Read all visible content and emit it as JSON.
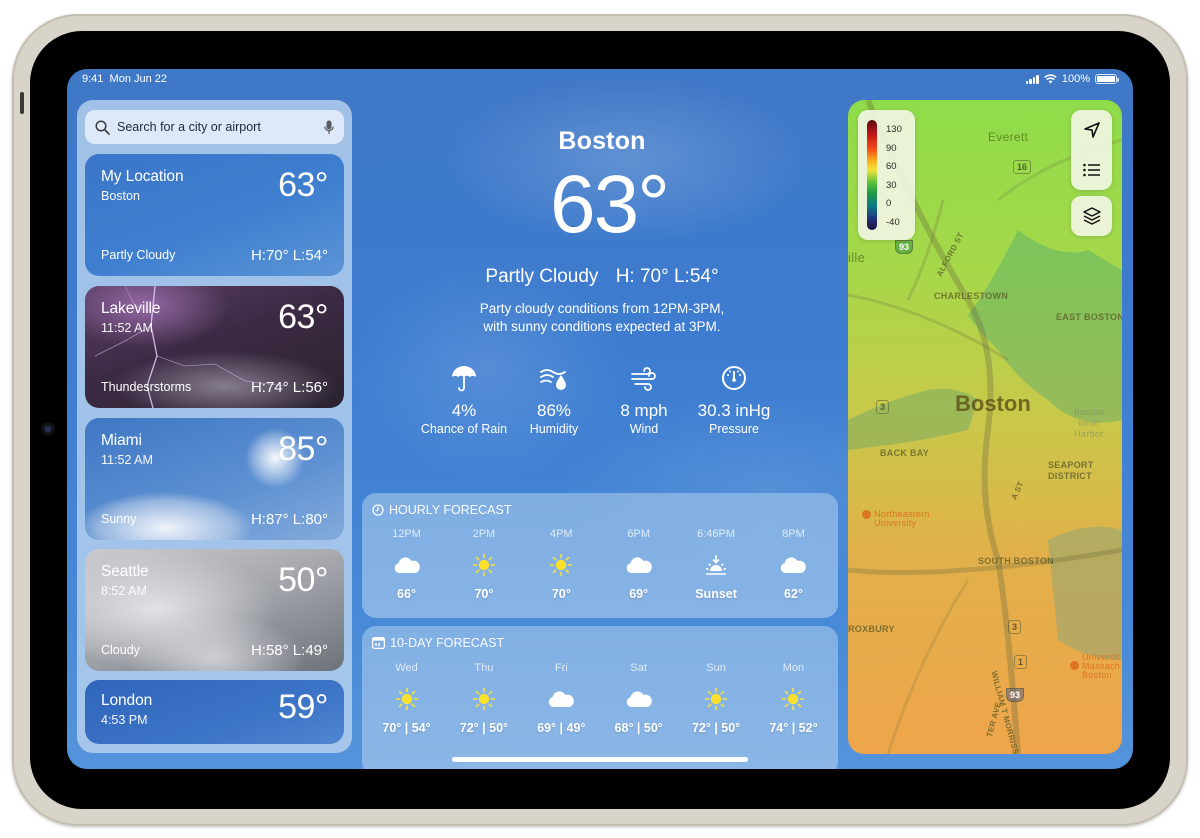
{
  "status_bar": {
    "time": "9:41",
    "date": "Mon Jun 22",
    "battery": "100%",
    "battery_level": 1.0
  },
  "sidebar": {
    "search": {
      "placeholder": "Search for a city or airport",
      "icon": "search-icon",
      "mic_icon": "microphone-icon"
    },
    "locations": [
      {
        "city": "My Location",
        "subtitle": "Boston",
        "temp": "63°",
        "condition": "Partly Cloudy",
        "high_low": "H:70° L:54°"
      },
      {
        "city": "Lakeville",
        "subtitle": "11:52 AM",
        "temp": "63°",
        "condition": "Thundesrstorms",
        "high_low": "H:74° L:56°"
      },
      {
        "city": "Miami",
        "subtitle": "11:52 AM",
        "temp": "85°",
        "condition": "Sunny",
        "high_low": "H:87° L:80°"
      },
      {
        "city": "Seattle",
        "subtitle": "8:52 AM",
        "temp": "50°",
        "condition": "Cloudy",
        "high_low": "H:58° L:49°"
      },
      {
        "city": "London",
        "subtitle": "4:53 PM",
        "temp": "59°",
        "condition": "",
        "high_low": ""
      }
    ]
  },
  "current": {
    "city": "Boston",
    "temp": "63°",
    "condition": "Partly Cloudy",
    "high_low": "H: 70° L:54°",
    "summary_line1": "Party cloudy conditions from 12PM-3PM,",
    "summary_line2": "with sunny conditions expected at 3PM.",
    "metrics": [
      {
        "icon": "umbrella-icon",
        "value": "4%",
        "label": "Chance of Rain"
      },
      {
        "icon": "humidity-icon",
        "value": "86%",
        "label": "Humidity"
      },
      {
        "icon": "wind-icon",
        "value": "8 mph",
        "label": "Wind"
      },
      {
        "icon": "pressure-gauge-icon",
        "value": "30.3 inHg",
        "label": "Pressure"
      }
    ]
  },
  "hourly": {
    "title": "HOURLY FORECAST",
    "icon": "clock-icon",
    "items": [
      {
        "time": "12PM",
        "icon": "cloud-icon",
        "value": "66°"
      },
      {
        "time": "2PM",
        "icon": "sun-icon",
        "value": "70°"
      },
      {
        "time": "4PM",
        "icon": "sun-icon",
        "value": "70°"
      },
      {
        "time": "6PM",
        "icon": "cloud-icon",
        "value": "69°"
      },
      {
        "time": "6:46PM",
        "icon": "sunset-icon",
        "value": "Sunset"
      },
      {
        "time": "8PM",
        "icon": "cloud-icon",
        "value": "62°"
      }
    ]
  },
  "daily": {
    "title": "10-DAY FORECAST",
    "icon": "calendar-icon",
    "items": [
      {
        "day": "Wed",
        "icon": "sun-icon",
        "value": "70° | 54°"
      },
      {
        "day": "Thu",
        "icon": "sun-icon",
        "value": "72° | 50°"
      },
      {
        "day": "Fri",
        "icon": "cloud-icon",
        "value": "69° | 49°"
      },
      {
        "day": "Sat",
        "icon": "cloud-icon",
        "value": "68° | 50°"
      },
      {
        "day": "Sun",
        "icon": "sun-icon",
        "value": "72° | 50°"
      },
      {
        "day": "Mon",
        "icon": "sun-icon",
        "value": "74° | 52°"
      }
    ]
  },
  "map": {
    "legend_ticks": [
      "130",
      "90",
      "60",
      "30",
      "0",
      "-40"
    ],
    "labels": {
      "everett": "Everett",
      "ville": "ille",
      "alford": "ALFORD ST",
      "charlestown": "CHARLESTOWN",
      "east_boston": "EAST BOSTON",
      "boston": "Boston",
      "back_bay": "BACK BAY",
      "seaport1": "SEAPORT",
      "seaport2": "DISTRICT",
      "northeastern1": "Northeastern",
      "northeastern2": "University",
      "south_boston": "SOUTH BOSTON",
      "roxbury": "ROXBURY",
      "a_st": "A ST",
      "morrissey": "WILLIAM T MORRISSEY BLVD",
      "umass1": "Universit",
      "umass2": "Massach",
      "umass3": "Boston",
      "harbor1": "Boston",
      "harbor2": "Inner",
      "harbor3": "Harbor",
      "ter_ave": "TER AVE"
    },
    "shields": [
      "16",
      "93",
      "3",
      "3",
      "1",
      "93"
    ],
    "buttons": {
      "location": "location-arrow-icon",
      "list": "list-icon",
      "layers": "layers-icon"
    }
  }
}
